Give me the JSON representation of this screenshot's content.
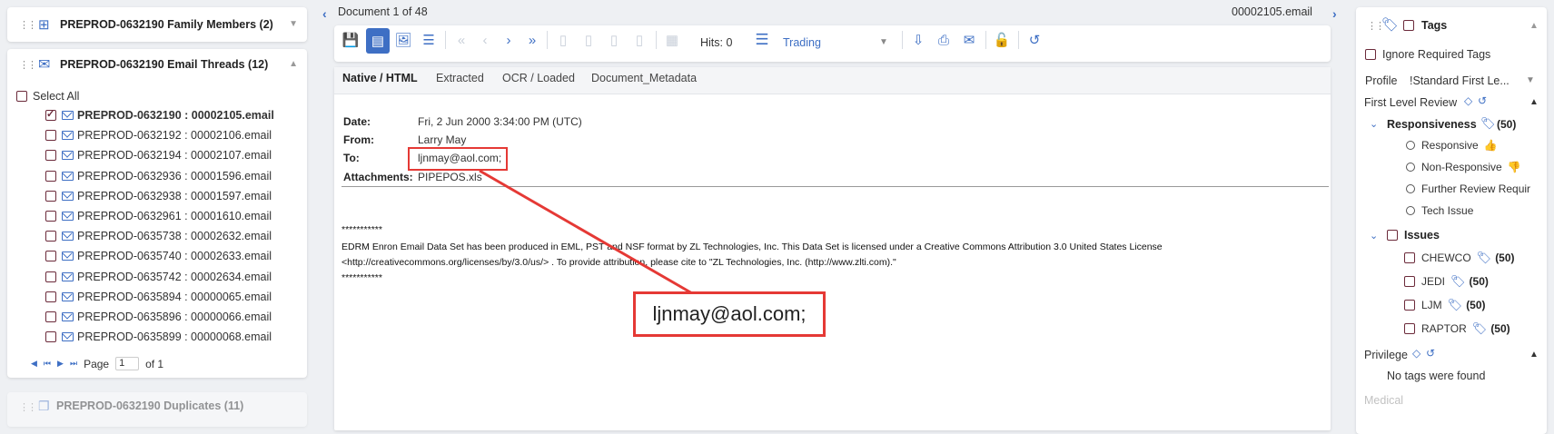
{
  "left": {
    "family": {
      "title": "PREPROD-0632190 Family Members (2)"
    },
    "threads": {
      "title": "PREPROD-0632190 Email Threads (12)",
      "select_all": "Select All",
      "items": [
        {
          "label": "PREPROD-0632190 : 00002105.email",
          "checked": true
        },
        {
          "label": "PREPROD-0632192 : 00002106.email",
          "checked": false
        },
        {
          "label": "PREPROD-0632194 : 00002107.email",
          "checked": false
        },
        {
          "label": "PREPROD-0632936 : 00001596.email",
          "checked": false
        },
        {
          "label": "PREPROD-0632938 : 00001597.email",
          "checked": false
        },
        {
          "label": "PREPROD-0632961 : 00001610.email",
          "checked": false
        },
        {
          "label": "PREPROD-0635738 : 00002632.email",
          "checked": false
        },
        {
          "label": "PREPROD-0635740 : 00002633.email",
          "checked": false
        },
        {
          "label": "PREPROD-0635742 : 00002634.email",
          "checked": false
        },
        {
          "label": "PREPROD-0635894 : 00000065.email",
          "checked": false
        },
        {
          "label": "PREPROD-0635896 : 00000066.email",
          "checked": false
        },
        {
          "label": "PREPROD-0635899 : 00000068.email",
          "checked": false
        }
      ],
      "pager": {
        "page_label": "Page",
        "page_value": "1",
        "of_label": "of 1"
      }
    },
    "duplicates": {
      "title": "PREPROD-0632190 Duplicates (11)"
    }
  },
  "doc": {
    "position": "Document 1 of 48",
    "filename": "00002105.email",
    "hits": "Hits: 0",
    "list_value": "Trading",
    "tabs": [
      "Native / HTML",
      "Extracted",
      "OCR / Loaded",
      "Document_Metadata"
    ],
    "header": {
      "date_label": "Date:",
      "date_value": "Fri, 2 Jun 2000 3:34:00 PM (UTC)",
      "from_label": "From:",
      "from_value": "Larry May",
      "to_label": "To:",
      "to_value": "ljnmay@aol.com;",
      "att_label": "Attachments:",
      "att_value": "PIPEPOS.xls"
    },
    "body": {
      "stars1": "***********",
      "line1": "EDRM Enron Email Data Set has been produced in EML, PST and NSF format by ZL Technologies, Inc. This Data Set is licensed under a Creative Commons Attribution 3.0 United States License",
      "line2": "<http://creativecommons.org/licenses/by/3.0/us/> . To provide attribution, please cite to \"ZL Technologies, Inc. (http://www.zlti.com).\"",
      "stars2": "***********"
    },
    "zoom_text": "ljnmay@aol.com;",
    "highlight_color": "#e53935"
  },
  "tags": {
    "title": "Tags",
    "ignore_required": "Ignore Required Tags",
    "profile_label": "Profile",
    "profile_value": "!Standard First Le...",
    "first_level": "First Level Review",
    "responsiveness": {
      "label": "Responsiveness",
      "count": "(50)",
      "options": [
        "Responsive",
        "Non-Responsive",
        "Further Review Requir",
        "Tech Issue"
      ]
    },
    "issues": {
      "label": "Issues",
      "items": [
        {
          "label": "CHEWCO",
          "count": "(50)"
        },
        {
          "label": "JEDI",
          "count": "(50)"
        },
        {
          "label": "LJM",
          "count": "(50)"
        },
        {
          "label": "RAPTOR",
          "count": "(50)"
        }
      ]
    },
    "privilege": {
      "label": "Privilege",
      "empty": "No tags were found"
    },
    "medical": "Medical"
  },
  "colors": {
    "accent": "#3e6fc4",
    "checkbox": "#6b2a3a"
  }
}
